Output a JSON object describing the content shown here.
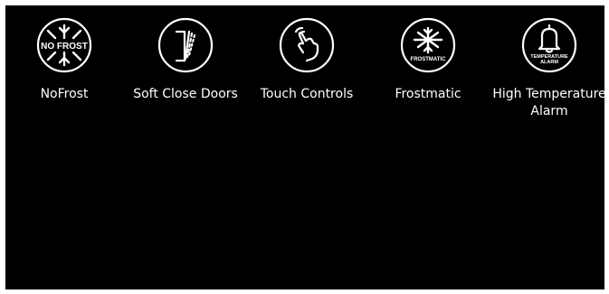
{
  "colors": {
    "background": "#000000",
    "foreground": "#ffffff"
  },
  "features": [
    {
      "label": "NoFrost",
      "icon": "nofrost-snowflake-icon",
      "badge": "NO FROST"
    },
    {
      "label": "Soft Close Doors",
      "icon": "soft-close-door-icon"
    },
    {
      "label": "Touch Controls",
      "icon": "touch-hand-icon"
    },
    {
      "label": "Frostmatic",
      "icon": "frostmatic-snowflake-icon",
      "badge": "FROSTMATIC"
    },
    {
      "label": "High Temperature\nAlarm",
      "icon": "bell-alarm-icon",
      "badge_line1": "TEMPERATURE",
      "badge_line2": "ALARM"
    }
  ]
}
